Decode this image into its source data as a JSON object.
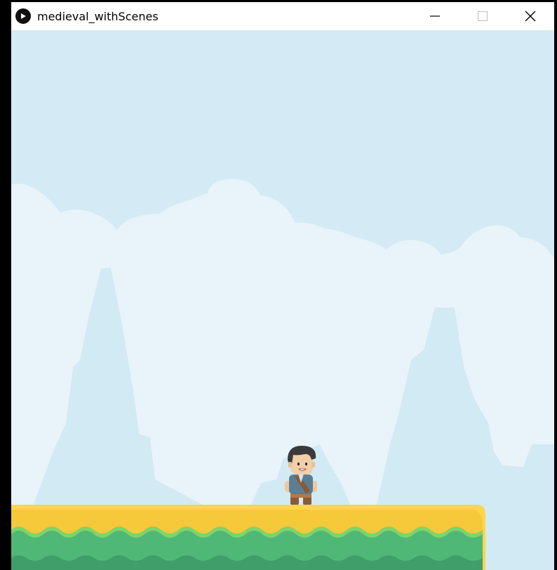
{
  "window": {
    "title": "medieval_withScenes",
    "controls": [
      "minimize",
      "maximize",
      "close"
    ]
  },
  "icons": {
    "app": "play-icon",
    "minimize": "minimize-icon",
    "maximize": "maximize-icon",
    "close": "close-icon"
  },
  "colors": {
    "sky": "#d4ebf5",
    "clouds": "#e8f4f9",
    "mountains": "#d2eaf4",
    "platform_top": "#ffd54a",
    "grass_light": "#7fd36a",
    "grass": "#4fb877",
    "grass_dark": "#3f9e6a"
  },
  "game": {
    "player": "knight-character",
    "platform": "grass-platform"
  }
}
